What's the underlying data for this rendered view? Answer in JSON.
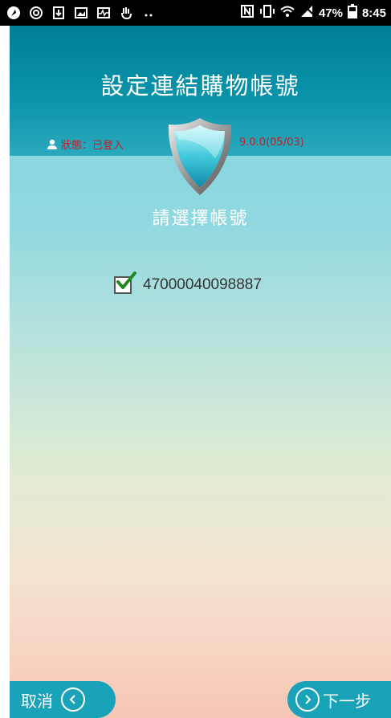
{
  "status_bar": {
    "battery_percent": "47%",
    "time": "8:45",
    "icons": [
      "app-icon",
      "settings-icon",
      "download-icon",
      "image-icon",
      "pulse-icon",
      "hand-icon",
      "dots-icon",
      "nfc-icon",
      "vibrate-icon",
      "wifi-icon",
      "signal-icon",
      "battery-icon"
    ]
  },
  "header": {
    "title": "設定連結購物帳號",
    "status_label": "狀態：已登入",
    "version": "9.0.0(05/03)"
  },
  "main": {
    "subtitle": "請選擇帳號",
    "account": {
      "number": "47000040098887",
      "checked": true
    }
  },
  "footer": {
    "cancel_label": "取消",
    "next_label": "下一步"
  },
  "colors": {
    "header_teal": "#0a93aa",
    "status_red": "#c0202a",
    "button_teal": "#1aa3b8"
  }
}
